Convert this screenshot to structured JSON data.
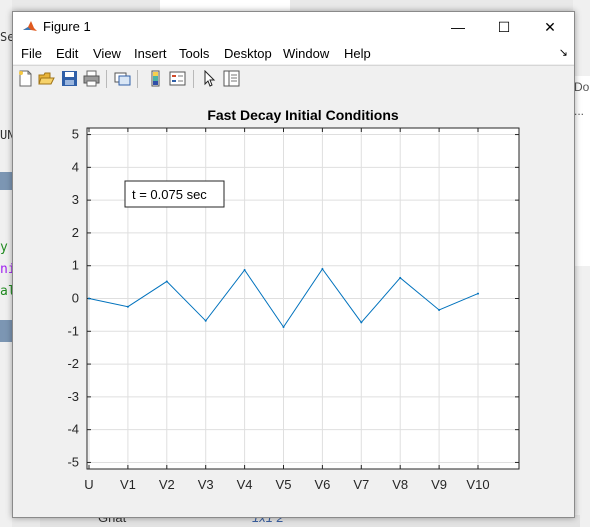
{
  "window": {
    "title": "Figure 1",
    "controls": {
      "minimize": "—",
      "maximize": "☐",
      "close": "✕"
    }
  },
  "menu": {
    "items": [
      "File",
      "Edit",
      "View",
      "Insert",
      "Tools",
      "Desktop",
      "Window",
      "Help"
    ],
    "dock_glyph": "↘"
  },
  "toolbar": {
    "icons": [
      "new-figure-icon",
      "open-file-icon",
      "save-icon",
      "print-icon",
      "link-plot-icon",
      "insert-colorbar-icon",
      "insert-legend-icon",
      "pointer-icon",
      "property-inspector-icon"
    ]
  },
  "background": {
    "left_code_lines": [
      {
        "text": "y",
        "color": "#228b22"
      },
      {
        "text": "ni",
        "color": "#a020f0"
      },
      {
        "text": "al",
        "color": "#228b22"
      }
    ],
    "right_texts": [
      "Do",
      "..."
    ],
    "left_texts": [
      "Se",
      "UN"
    ],
    "bottom_texts": [
      "Ghat",
      "1x1 2"
    ]
  },
  "chart_data": {
    "type": "line",
    "title": "Fast Decay Initial Conditions",
    "xlabel": "",
    "ylabel": "",
    "categories": [
      "U",
      "V1",
      "V2",
      "V3",
      "V4",
      "V5",
      "V6",
      "V7",
      "V8",
      "V9",
      "V10"
    ],
    "series": [
      {
        "values": [
          0.0,
          -0.25,
          0.52,
          -0.68,
          0.87,
          -0.87,
          0.9,
          -0.73,
          0.63,
          -0.35,
          0.15
        ],
        "color": "#0072bd"
      }
    ],
    "ylim": [
      -5.2,
      5.2
    ],
    "yticks": [
      5,
      4,
      3,
      2,
      1,
      0,
      -1,
      -2,
      -3,
      -4,
      -5
    ],
    "grid": true,
    "annotation": "t = 0.075 sec"
  }
}
